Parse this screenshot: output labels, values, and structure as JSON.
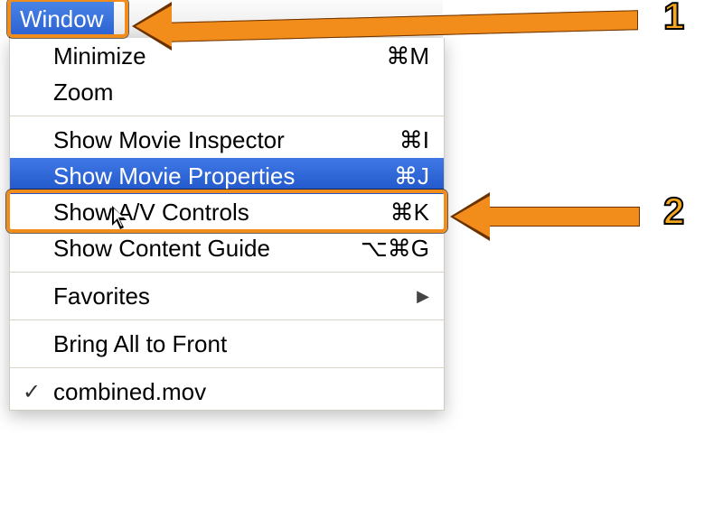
{
  "menubar": {
    "title": "Window"
  },
  "menu": {
    "items": [
      {
        "label": "Minimize",
        "shortcut": "⌘M"
      },
      {
        "label": "Zoom",
        "shortcut": ""
      }
    ],
    "items2": [
      {
        "label": "Show Movie Inspector",
        "shortcut": "⌘I"
      },
      {
        "label": "Show Movie Properties",
        "shortcut": "⌘J",
        "selected": true
      },
      {
        "label": "Show A/V Controls",
        "shortcut": "⌘K"
      },
      {
        "label": "Show Content Guide",
        "shortcut": "⌥⌘G"
      }
    ],
    "favorites_label": "Favorites",
    "bring_front_label": "Bring All to Front",
    "window_item": "combined.mov"
  },
  "annotations": {
    "step1": "1",
    "step2": "2"
  },
  "colors": {
    "highlight_orange": "#f28c1a",
    "selection_blue": "#2a5fd0"
  }
}
